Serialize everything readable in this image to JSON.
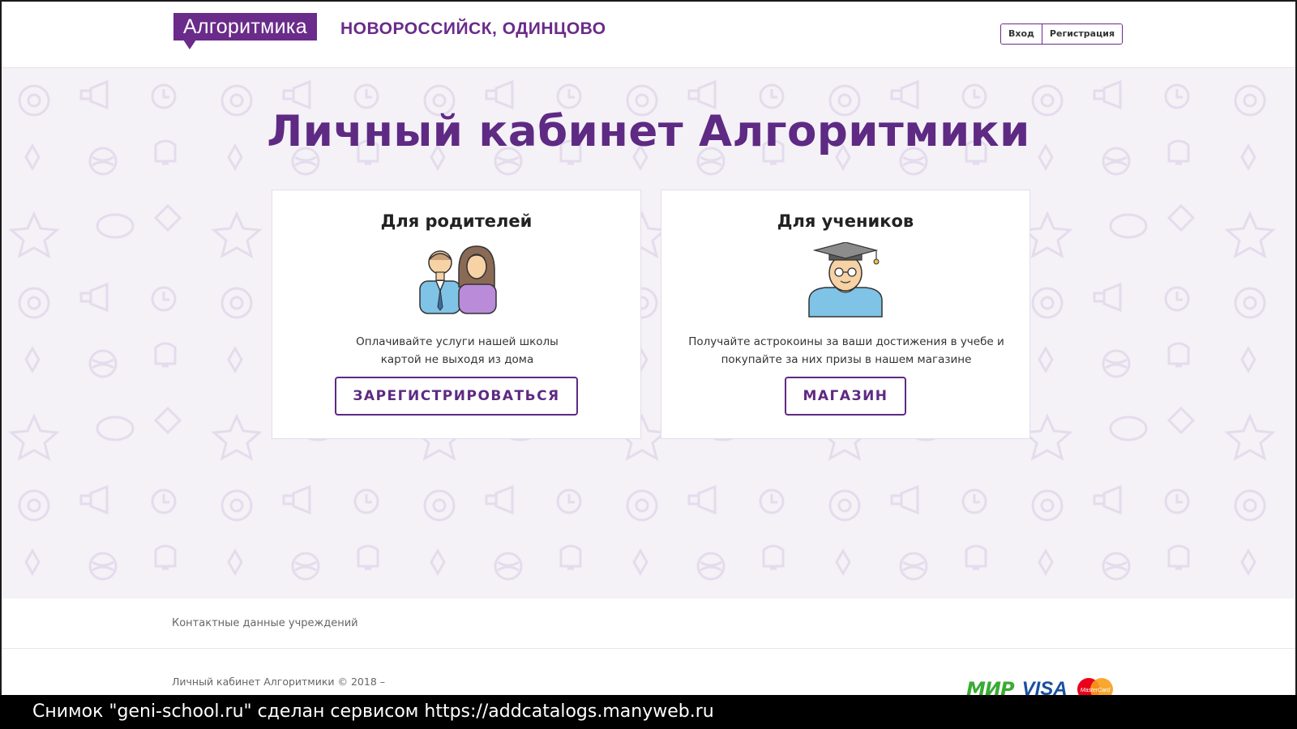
{
  "header": {
    "logo_text": "Алгоритмика",
    "city": "НОВОРОССИЙСК, ОДИНЦОВО",
    "login_label": "Вход",
    "register_label": "Регистрация"
  },
  "hero": {
    "title": "Личный кабинет Алгоритмики"
  },
  "cards": {
    "parents": {
      "title": "Для родителей",
      "text_line1": "Оплачивайте услуги нашей школы",
      "text_line2": "картой не выходя из дома",
      "button": "ЗАРЕГИСТРИРОВАТЬСЯ"
    },
    "students": {
      "title": "Для учеников",
      "text_line1": "Получайте астрокоины за ваши достижения в учебе и",
      "text_line2": "покупайте за них призы в нашем магазине",
      "button": "МАГАЗИН"
    }
  },
  "footer": {
    "contacts_link": "Контактные данные учреждений",
    "copyright": "Личный кабинет Алгоритмики © 2018 –",
    "payments": {
      "mir": "МИР",
      "visa": "VISA",
      "mastercard": "MasterCard"
    }
  },
  "watermark": {
    "text": "Снимок \"geni-school.ru\" сделан сервисом https://addcatalogs.manyweb.ru"
  },
  "colors": {
    "brand_purple": "#6a2b8a",
    "title_purple": "#5e2a83",
    "hero_background": "#f4f1f7"
  }
}
